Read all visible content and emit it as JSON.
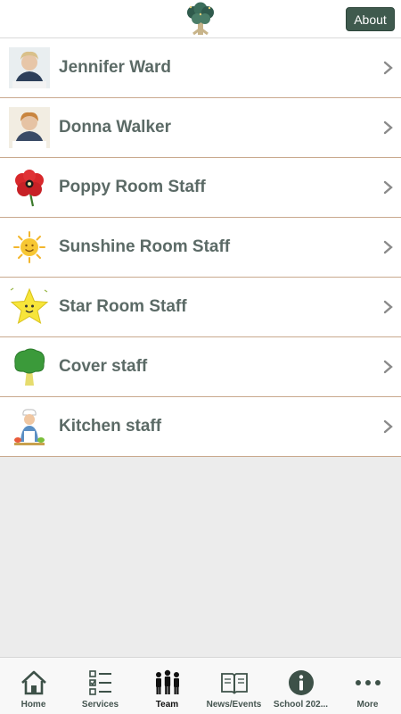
{
  "header": {
    "about_label": "About",
    "logo_icon": "tree-logo-icon"
  },
  "staff_list": [
    {
      "label": "Jennifer Ward",
      "icon": "jennifer-ward-photo"
    },
    {
      "label": "Donna Walker",
      "icon": "donna-walker-photo"
    },
    {
      "label": "Poppy Room Staff",
      "icon": "poppy-icon"
    },
    {
      "label": "Sunshine Room Staff",
      "icon": "sun-icon"
    },
    {
      "label": "Star Room Staff",
      "icon": "star-icon"
    },
    {
      "label": "Cover staff",
      "icon": "tree-icon"
    },
    {
      "label": "Kitchen staff",
      "icon": "chef-icon"
    }
  ],
  "tabbar": [
    {
      "label": "Home",
      "icon": "home-icon"
    },
    {
      "label": "Services",
      "icon": "checklist-icon"
    },
    {
      "label": "Team",
      "icon": "team-icon",
      "active": true
    },
    {
      "label": "News/Events",
      "icon": "book-icon"
    },
    {
      "label": "School 202...",
      "icon": "info-icon"
    },
    {
      "label": "More",
      "icon": "more-dots-icon"
    }
  ],
  "colors": {
    "accent": "#3f5a4e",
    "row_divider": "#c9a98e",
    "label_text": "#5b6a66",
    "background": "#ececec"
  }
}
